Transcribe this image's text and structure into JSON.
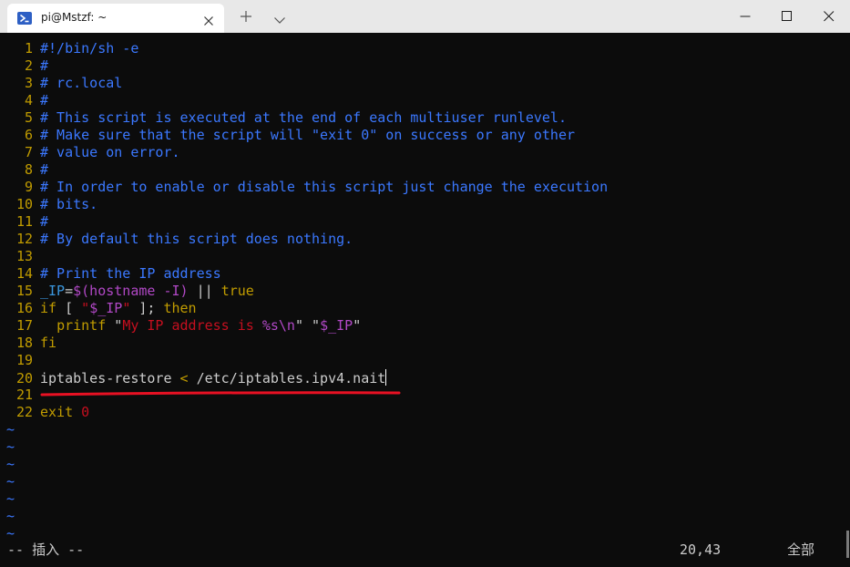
{
  "window": {
    "tab_title": "pi@Mstzf: ~",
    "icons": {
      "tab": "powershell-icon",
      "close_tab": "close-icon",
      "new_tab": "plus-icon",
      "dropdown": "chevron-down-icon",
      "minimize": "minimize-icon",
      "maximize": "maximize-icon",
      "close": "close-icon"
    }
  },
  "editor": {
    "line_numbers": [
      "1",
      "2",
      "3",
      "4",
      "5",
      "6",
      "7",
      "8",
      "9",
      "10",
      "11",
      "12",
      "13",
      "14",
      "15",
      "16",
      "17",
      "18",
      "19",
      "20",
      "21",
      "22"
    ],
    "lines": {
      "l1": "#!/bin/sh -e",
      "l2": "#",
      "l3": "# rc.local",
      "l4": "#",
      "l5": "# This script is executed at the end of each multiuser runlevel.",
      "l6": "# Make sure that the script will \"exit 0\" on success or any other",
      "l7": "# value on error.",
      "l8": "#",
      "l9": "# In order to enable or disable this script just change the execution",
      "l10": "# bits.",
      "l11": "#",
      "l12": "# By default this script does nothing.",
      "l13": "",
      "l14": "# Print the IP address",
      "l15": {
        "var": "_IP",
        "eq": "=",
        "subst": "$(hostname -I)",
        "sp": " ",
        "or": "||",
        "sp2": " ",
        "val": "true"
      },
      "l16": {
        "kw1": "if",
        "br1": " [ ",
        "q1": "\"",
        "v": "$_IP",
        "q2": "\"",
        "br2": " ]; ",
        "kw2": "then"
      },
      "l17": {
        "indent": "  ",
        "cmd": "printf",
        "sp": " ",
        "q1": "\"",
        "str": "My IP address is ",
        "fmt": "%s\\n",
        "q2": "\"",
        "sp2": " ",
        "q3": "\"",
        "v": "$_IP",
        "q4": "\""
      },
      "l18": "fi",
      "l19": "",
      "l20": {
        "cmd": "iptables-restore ",
        "redir": "<",
        "path": " /etc/iptables.ipv4.nait"
      },
      "l21": "",
      "l22": {
        "cmd": "exit",
        "sp": " ",
        "code": "0"
      }
    },
    "tilde": "~",
    "annotation_color": "#e81123"
  },
  "status": {
    "mode": "-- 插入 --",
    "position": "20,43",
    "scroll": "全部"
  },
  "colors": {
    "comment": "#3b78ff",
    "keyword": "#c19c00",
    "variable": "#3a96dd",
    "substitution": "#b148c6",
    "string": "#c50f1f",
    "plain": "#cccccc",
    "background": "#0c0c0c"
  }
}
